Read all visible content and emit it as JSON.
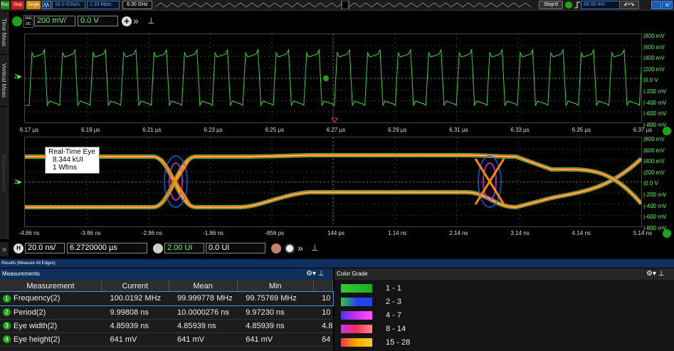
{
  "toolbar": {
    "run": "Run",
    "stop": "Stop",
    "single": "Single",
    "sample_rate": "16.0 GSa/s",
    "mem_depth": "1.33 Mpts",
    "freq": "6.30 GHz",
    "status": "Stop'd",
    "trigger_level": "68.00 mV"
  },
  "tabs": {
    "time_meas": "Time Meas",
    "vertical_meas": "Vertical Meas",
    "measurements": "Measurements"
  },
  "channel": {
    "coupling_top": "50Ω",
    "coupling_bot": "DC",
    "scale": "200 mV/",
    "offset": "0.0 V"
  },
  "upper_plot": {
    "x_ticks": [
      "6.17 µs",
      "6.19 µs",
      "6.21 µs",
      "6.23 µs",
      "6.25 µs",
      "6.27 µs",
      "6.29 µs",
      "6.31 µs",
      "6.33 µs",
      "6.35 µs",
      "6.37 µs"
    ],
    "y_ticks": [
      "800 mV",
      "600 mV",
      "400 mV",
      "200 mV",
      "0.0 V",
      "-200 mV",
      "-400 mV",
      "-600 mV",
      "-800 mV"
    ]
  },
  "lower_plot": {
    "x_ticks": [
      "-4.86 ns",
      "-3.86 ns",
      "-2.86 ns",
      "-1.86 ns",
      "-856 ps",
      "144 ps",
      "1.14 ns",
      "2.14 ns",
      "3.14 ns",
      "4.14 ns",
      "5.14 ns"
    ],
    "y_ticks": [
      "800 mV",
      "600 mV",
      "400 mV",
      "200 mV",
      "0.0 V",
      "-200 mV",
      "-400 mV",
      "-600 mV",
      "-800 mV"
    ],
    "legend": {
      "title": "Real-Time Eye",
      "line1": "8.344 kUI",
      "line2": "1 Wfms"
    }
  },
  "horizontal": {
    "badge": "H",
    "scale": "20.0 ns/",
    "position": "6.2720000 µs",
    "ui_scale": "2.00 UI",
    "ui_offset": "0.0 UI"
  },
  "results_bar": "Results  (Measure All Edges)",
  "measurements": {
    "title": "Measurements",
    "headers": [
      "Measurement",
      "Current",
      "Mean",
      "Min"
    ],
    "rows": [
      {
        "n": "1",
        "name": "Frequency(2)",
        "current": "100.0192 MHz",
        "mean": "99.999778 MHz",
        "min": "99.75769 MHz",
        "extra": "10"
      },
      {
        "n": "2",
        "name": "Period(2)",
        "current": "9.99808 ns",
        "mean": "10.0000276 ns",
        "min": "9.97230 ns",
        "extra": "10"
      },
      {
        "n": "3",
        "name": "Eye width(2)",
        "current": "4.85939 ns",
        "mean": "4.85939 ns",
        "min": "4.85939 ns",
        "extra": "4.8"
      },
      {
        "n": "4",
        "name": "Eye height(2)",
        "current": "641 mV",
        "mean": "641 mV",
        "min": "641 mV",
        "extra": "64"
      }
    ]
  },
  "color_grade": {
    "title": "Color Grade",
    "rows": [
      {
        "label": "1 - 1",
        "color": "#33cc33"
      },
      {
        "label": "2 - 3",
        "color": "#2266ee"
      },
      {
        "label": "4 - 7",
        "color": "#cc33ee"
      },
      {
        "label": "8 - 14",
        "color": "#ee3355"
      },
      {
        "label": "15 - 28",
        "color": "#ffaa00"
      }
    ]
  }
}
